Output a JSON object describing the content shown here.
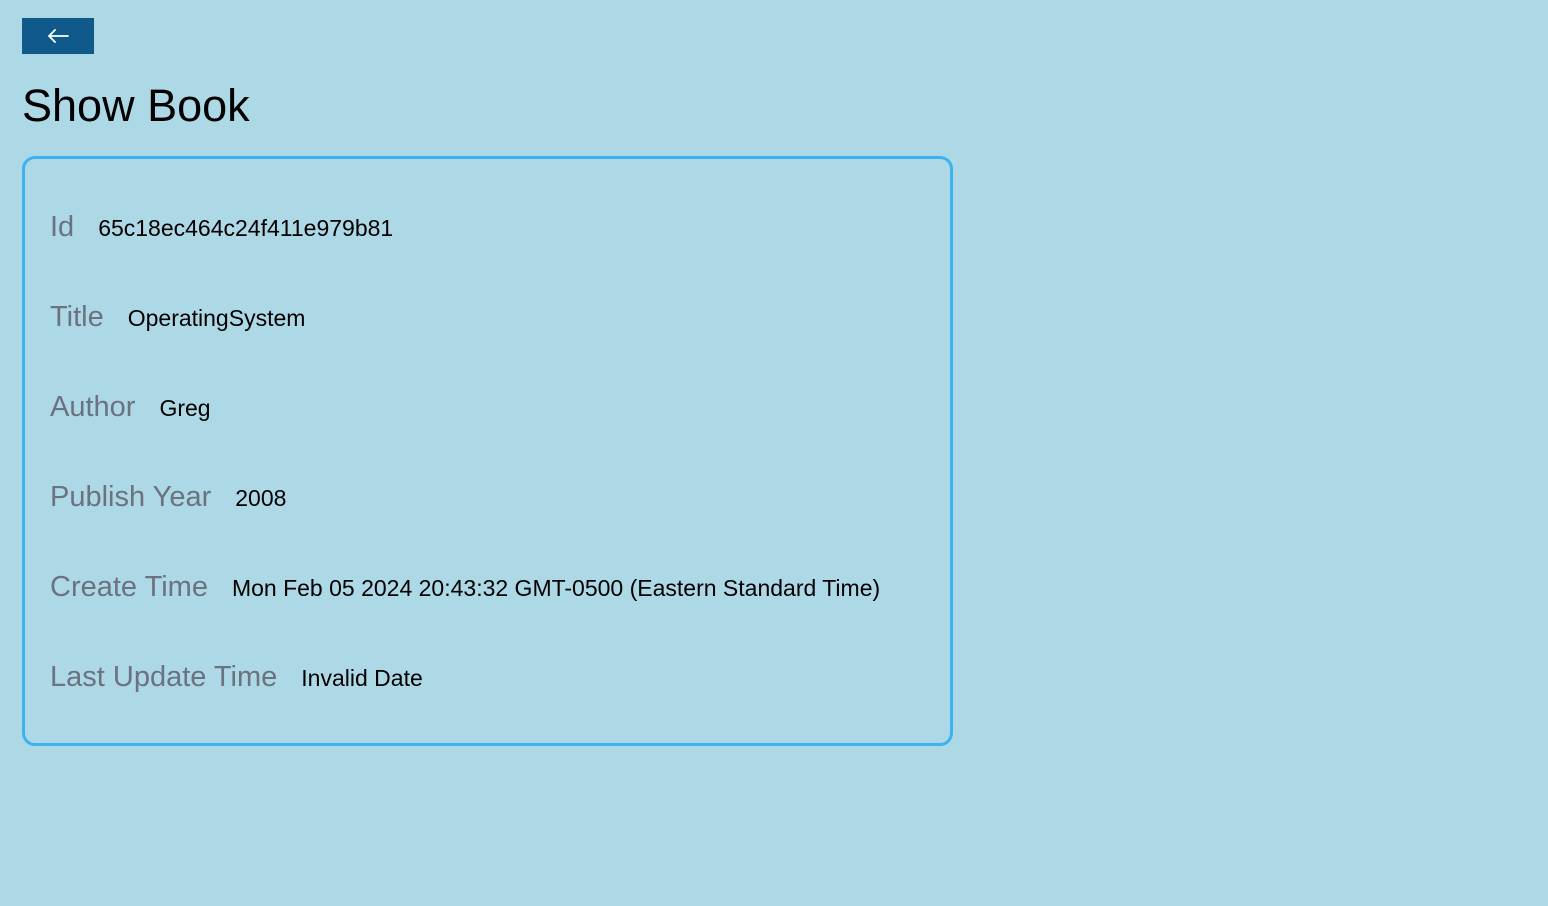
{
  "header": {
    "back_icon": "arrow-left-icon",
    "title": "Show Book"
  },
  "colors": {
    "background": "#add8e6",
    "back_button": "#0f5a8a",
    "card_border": "#3eb2ee",
    "label": "#6b7280"
  },
  "book": {
    "fields": [
      {
        "label": "Id",
        "value": "65c18ec464c24f411e979b81"
      },
      {
        "label": "Title",
        "value": "OperatingSystem"
      },
      {
        "label": "Author",
        "value": "Greg"
      },
      {
        "label": "Publish Year",
        "value": "2008"
      },
      {
        "label": "Create Time",
        "value": "Mon Feb 05 2024 20:43:32 GMT-0500 (Eastern Standard Time)"
      },
      {
        "label": "Last Update Time",
        "value": "Invalid Date"
      }
    ]
  }
}
